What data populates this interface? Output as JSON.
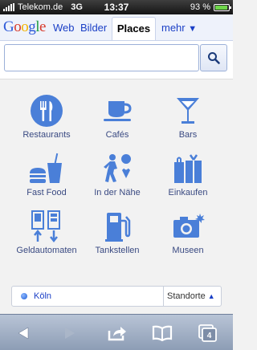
{
  "status_bar": {
    "carrier": "Telekom.de",
    "network": "3G",
    "time": "13:37",
    "battery": "93 %",
    "battery_level": 0.93
  },
  "header": {
    "logo": "Google",
    "tabs": [
      "Web",
      "Bilder",
      "Places"
    ],
    "active_tab": "Places",
    "more_label": "mehr",
    "more_icon": "chevron-down-icon"
  },
  "search": {
    "value": "",
    "button_icon": "search-icon"
  },
  "categories": [
    {
      "label": "Restaurants",
      "icon": "restaurant-icon"
    },
    {
      "label": "Cafés",
      "icon": "cafe-icon"
    },
    {
      "label": "Bars",
      "icon": "bar-icon"
    },
    {
      "label": "Fast Food",
      "icon": "fast-food-icon"
    },
    {
      "label": "In der Nähe",
      "icon": "nearby-icon"
    },
    {
      "label": "Einkaufen",
      "icon": "shopping-icon"
    },
    {
      "label": "Geldautomaten",
      "icon": "atm-icon"
    },
    {
      "label": "Tankstellen",
      "icon": "gas-station-icon"
    },
    {
      "label": "Museen",
      "icon": "museum-icon"
    }
  ],
  "location": {
    "city": "Köln",
    "button_label": "Standorte"
  },
  "toolbar": {
    "tab_count": "4",
    "icons": [
      "back-icon",
      "forward-icon",
      "share-icon",
      "bookmarks-icon",
      "tabs-icon"
    ]
  },
  "colors": {
    "accent": "#1a3fc6",
    "icon_blue": "#4a7fd8"
  }
}
